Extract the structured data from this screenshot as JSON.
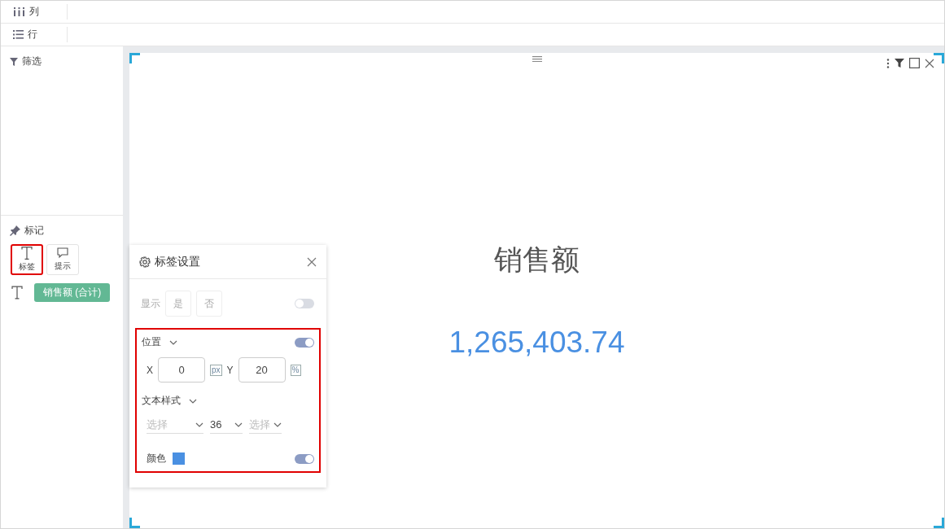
{
  "shelf_rows": [
    {
      "kind": "columns",
      "label": "列"
    },
    {
      "kind": "rows",
      "label": "行"
    }
  ],
  "filter_section": {
    "title": "筛选"
  },
  "marks_section": {
    "title": "标记",
    "mark_types": [
      {
        "kind": "text",
        "label": "标签",
        "selected": true
      },
      {
        "kind": "tooltip",
        "label": "提示",
        "selected": false
      }
    ],
    "fields": [
      {
        "kind": "text",
        "pill": "销售额 (合计)"
      }
    ]
  },
  "canvas": {
    "title": "销售额",
    "value": "1,265,403.74"
  },
  "label_settings": {
    "title": "标签设置",
    "show": {
      "label": "显示",
      "options": [
        "是",
        "否"
      ],
      "on": false
    },
    "highlighted": true,
    "position": {
      "label": "位置",
      "on": true,
      "x_label": "X",
      "x_value": "0",
      "x_unit": "px",
      "y_label": "Y",
      "y_value": "20",
      "y_unit": "%"
    },
    "text_style": {
      "label": "文本样式",
      "font_placeholder": "选择",
      "size": "36",
      "style_placeholder": "选择"
    },
    "color": {
      "label": "颜色",
      "color": "#4a90e2",
      "on": true
    }
  }
}
